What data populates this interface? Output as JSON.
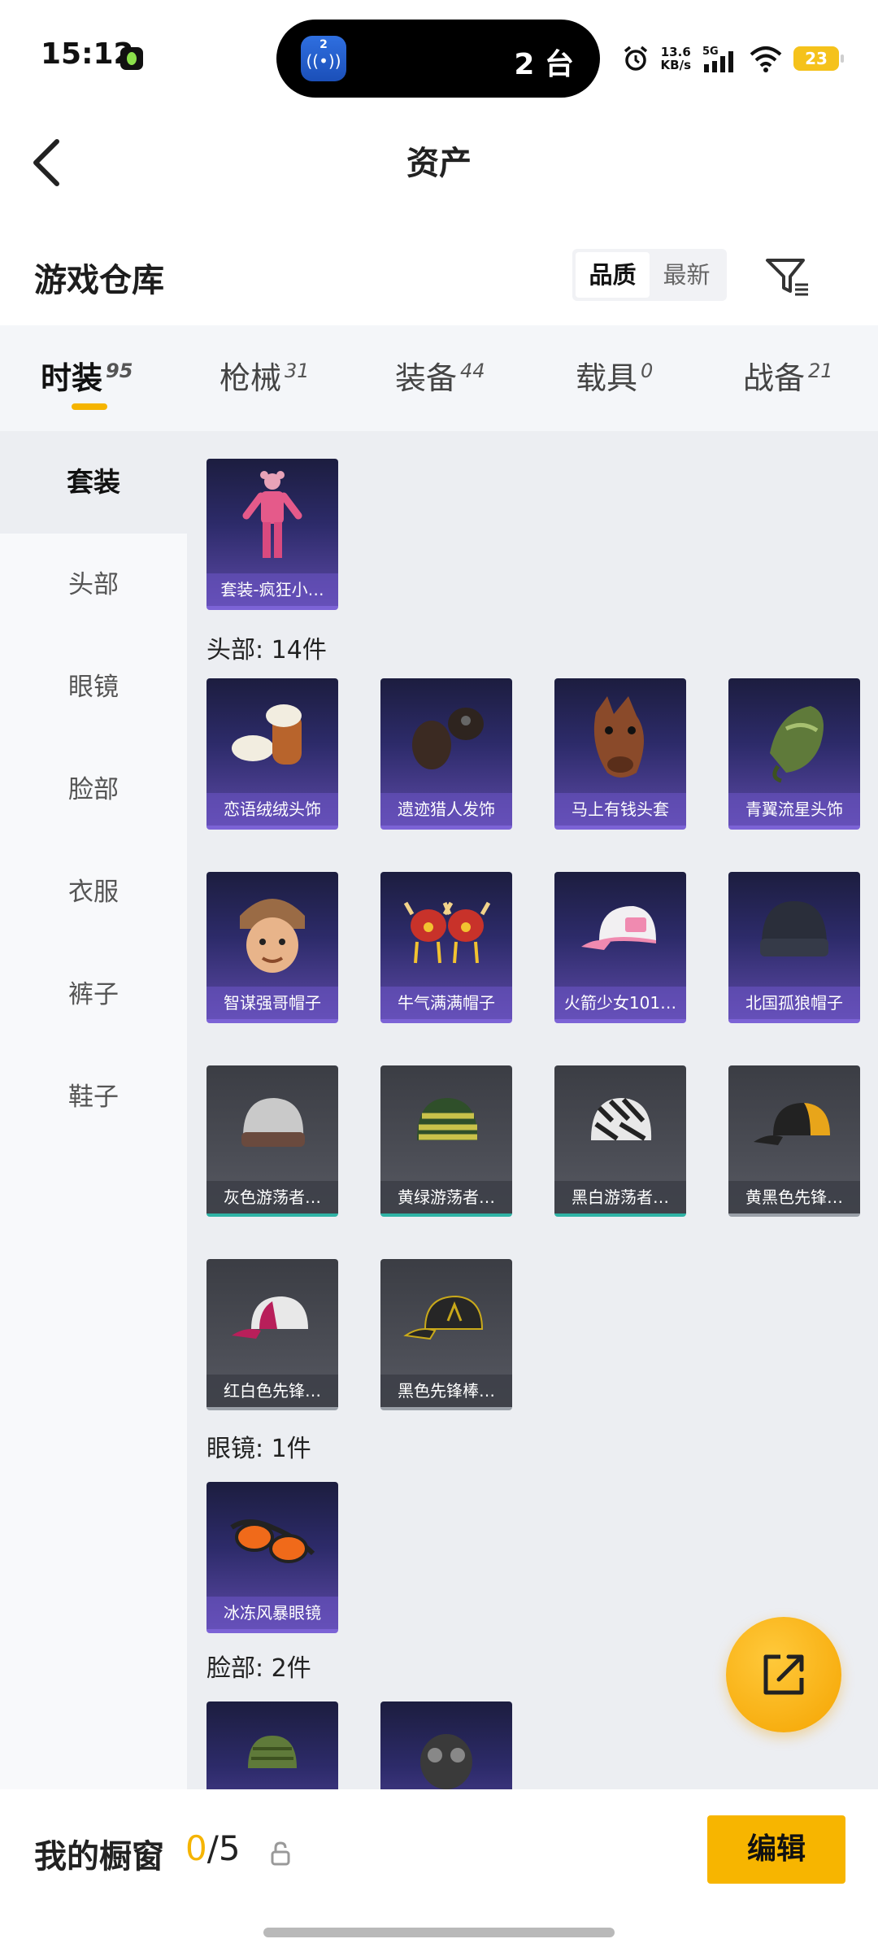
{
  "status_bar": {
    "time": "15:12",
    "island_text": "2 台",
    "island_app_badge": "2",
    "net_speed_value": "13.6",
    "net_speed_unit": "KB/s",
    "network_type": "5G",
    "battery": "23",
    "icons": [
      "app-notify-icon",
      "alarm-icon",
      "signal-icon",
      "wifi-icon",
      "battery-icon"
    ]
  },
  "nav": {
    "title": "资产",
    "back_icon": "chevron-left-icon"
  },
  "section": {
    "title": "游戏仓库",
    "sort_options": [
      "品质",
      "最新"
    ],
    "sort_selected": "品质",
    "filter_icon": "filter-icon"
  },
  "tabs": [
    {
      "label": "时装",
      "count": "95",
      "active": true
    },
    {
      "label": "枪械",
      "count": "31",
      "active": false
    },
    {
      "label": "装备",
      "count": "44",
      "active": false
    },
    {
      "label": "载具",
      "count": "0",
      "active": false
    },
    {
      "label": "战备",
      "count": "21",
      "active": false
    }
  ],
  "sidebar": {
    "items": [
      {
        "label": "套装",
        "active": true
      },
      {
        "label": "头部",
        "active": false
      },
      {
        "label": "眼镜",
        "active": false
      },
      {
        "label": "脸部",
        "active": false
      },
      {
        "label": "衣服",
        "active": false
      },
      {
        "label": "裤子",
        "active": false
      },
      {
        "label": "鞋子",
        "active": false
      }
    ]
  },
  "groups": {
    "suit": {
      "items": [
        {
          "name": "套装-疯狂小…",
          "rarity": "purple",
          "icon": "pink-suit-icon"
        }
      ]
    },
    "head": {
      "label": "头部: 14件",
      "items": [
        {
          "name": "恋语绒绒头饰",
          "rarity": "purple",
          "icon": "fluffy-headwear-icon"
        },
        {
          "name": "遗迹猎人发饰",
          "rarity": "purple",
          "icon": "hunter-hair-icon"
        },
        {
          "name": "马上有钱头套",
          "rarity": "purple",
          "icon": "horse-mask-icon"
        },
        {
          "name": "青翼流星头饰",
          "rarity": "purple",
          "icon": "green-wing-headwear-icon"
        },
        {
          "name": "智谋强哥帽子",
          "rarity": "purple",
          "icon": "fur-hat-head-icon"
        },
        {
          "name": "牛气满满帽子",
          "rarity": "purple",
          "icon": "ox-hat-icon"
        },
        {
          "name": "火箭少女101…",
          "rarity": "purple",
          "icon": "pink-cap-icon"
        },
        {
          "name": "北国孤狼帽子",
          "rarity": "purple",
          "icon": "black-beanie-icon"
        },
        {
          "name": "灰色游荡者…",
          "rarity": "grey-teal",
          "icon": "grey-beanie-icon"
        },
        {
          "name": "黄绿游荡者…",
          "rarity": "grey-teal",
          "icon": "striped-beanie-icon"
        },
        {
          "name": "黑白游荡者…",
          "rarity": "grey-teal",
          "icon": "zebra-beanie-icon"
        },
        {
          "name": "黄黑色先锋…",
          "rarity": "grey",
          "icon": "yellow-black-cap-icon"
        },
        {
          "name": "红白色先锋…",
          "rarity": "grey",
          "icon": "red-white-cap-icon"
        },
        {
          "name": "黑色先锋棒…",
          "rarity": "grey",
          "icon": "black-cap-icon"
        }
      ]
    },
    "glasses": {
      "label": "眼镜: 1件",
      "items": [
        {
          "name": "冰冻风暴眼镜",
          "rarity": "purple",
          "icon": "orange-goggles-icon"
        }
      ]
    },
    "face": {
      "label": "脸部: 2件",
      "items": [
        {
          "name": "",
          "rarity": "purple",
          "icon": "green-mask-icon"
        },
        {
          "name": "",
          "rarity": "purple",
          "icon": "plague-mask-icon"
        }
      ]
    }
  },
  "share_fab_icon": "share-icon",
  "showcase": {
    "title": "我的橱窗",
    "current": "0",
    "separator_total": "/5",
    "lock_icon": "lock-icon",
    "edit_label": "编辑"
  },
  "colors": {
    "accent": "#f5b400",
    "purple_rarity": "#7c63d6",
    "teal_rarity": "#2fb3a5"
  }
}
